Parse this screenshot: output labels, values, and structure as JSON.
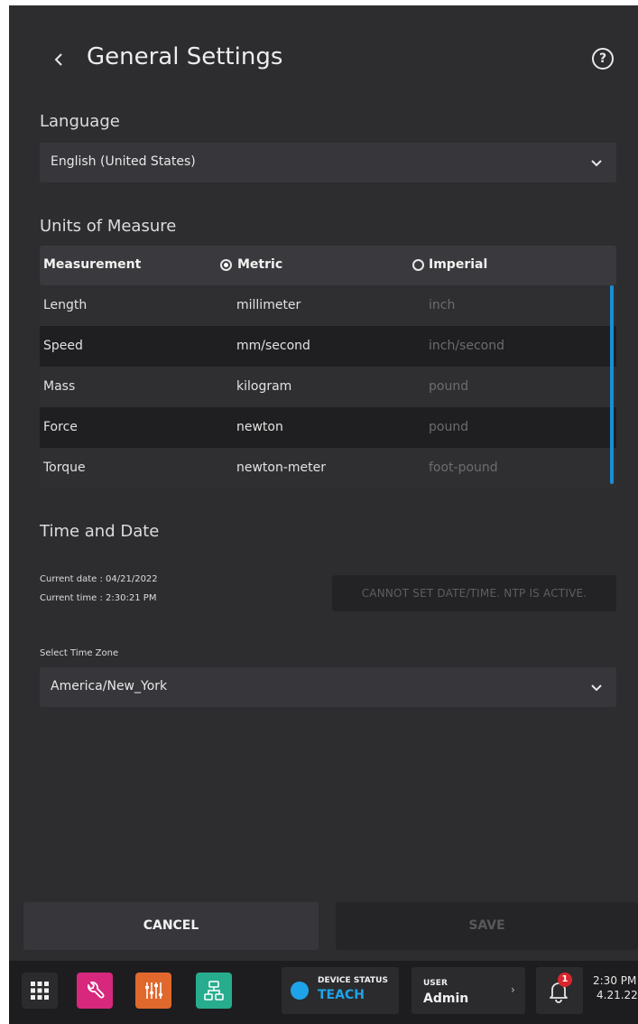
{
  "header": {
    "title": "General Settings",
    "back_icon": "chevron-left-icon",
    "help_icon": "question-circle-icon",
    "help_glyph": "?"
  },
  "language": {
    "label": "Language",
    "selected": "English (United States)"
  },
  "units": {
    "label": "Units of Measure",
    "columns": {
      "measurement": "Measurement",
      "metric": "Metric",
      "imperial": "Imperial"
    },
    "selected_system": "metric",
    "rows": [
      {
        "measurement": "Length",
        "metric": "millimeter",
        "imperial": "inch"
      },
      {
        "measurement": "Speed",
        "metric": "mm/second",
        "imperial": "inch/second"
      },
      {
        "measurement": "Mass",
        "metric": "kilogram",
        "imperial": "pound"
      },
      {
        "measurement": "Force",
        "metric": "newton",
        "imperial": "pound"
      },
      {
        "measurement": "Torque",
        "metric": "newton-meter",
        "imperial": "foot-pound"
      }
    ]
  },
  "time_date": {
    "label": "Time and Date",
    "current_date": "Current date : 04/21/2022",
    "current_time": "Current time : 2:30:21 PM",
    "ntp_button": "CANNOT SET DATE/TIME. NTP IS ACTIVE.",
    "timezone_label": "Select Time Zone",
    "timezone_selected": "America/New_York"
  },
  "actions": {
    "cancel": "CANCEL",
    "save": "SAVE"
  },
  "taskbar": {
    "device_status_title": "DEVICE STATUS",
    "device_status_value": "TEACH",
    "user_title": "USER",
    "user_value": "Admin",
    "notification_count": "1",
    "clock_time": "2:30 PM",
    "clock_date": "4.21.22",
    "chevron": "›"
  },
  "colors": {
    "background": "#2d2d30",
    "accent": "#1fa3e8",
    "wrench_app": "#d7287d",
    "tune_app": "#e0682d",
    "network_app": "#27ad8e",
    "badge": "#d8262c"
  }
}
